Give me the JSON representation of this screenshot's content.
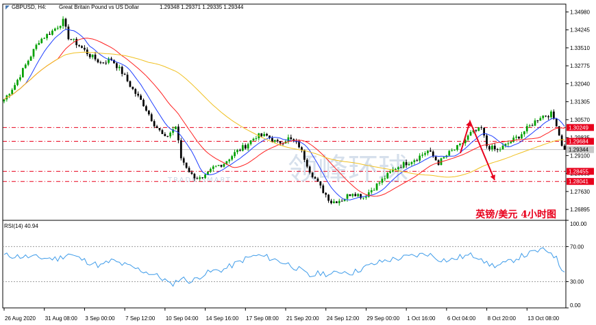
{
  "header": {
    "symbol": "GBPUSD, H4:",
    "description": "Great Britain Pound vs US Dollar",
    "ohlc": "1.29348 1.29371 1.29335 1.29344"
  },
  "annotation": {
    "title_cn": "英镑/美元 4小时图",
    "color": "#e8001c"
  },
  "watermark": {
    "latin": "TRADE SMART",
    "cn": "领峰环球",
    "color": "#c9d6e6"
  },
  "colors": {
    "up": "#00a000",
    "down": "#000000",
    "ma_fast": "#1f3fff",
    "ma_mid": "#ff2020",
    "ma_slow": "#f0c020",
    "level": "#e8001c",
    "rsi": "#3d9be9",
    "price_box": "#c8c8c8"
  },
  "chart_data": [
    {
      "type": "candlestick",
      "symbol": "GBPUSD",
      "timeframe": "H4",
      "ylim": [
        1.2645,
        1.353
      ],
      "yticks": [
        "1.34980",
        "1.34245",
        "1.33510",
        "1.32775",
        "1.32040",
        "1.31305",
        "1.30570",
        "1.29835",
        "1.29100",
        "1.28365",
        "1.27630",
        "1.26895"
      ],
      "xticks": [
        "26 Aug 2020",
        "31 Aug 08:00",
        "3 Sep 00:00",
        "7 Sep 12:00",
        "10 Sep 04:00",
        "14 Sep 16:00",
        "17 Sep 08:00",
        "21 Sep 20:00",
        "24 Sep 12:00",
        "29 Sep 00:00",
        "1 Oct 16:00",
        "6 Oct 04:00",
        "8 Oct 20:00",
        "13 Oct 08:00"
      ],
      "levels": [
        {
          "label": "1.30249",
          "value": 1.30249
        },
        {
          "label": "1.29684",
          "value": 1.29684
        },
        {
          "label": "1.28455",
          "value": 1.28455
        },
        {
          "label": "1.28041",
          "value": 1.28041
        }
      ],
      "current_price": {
        "label": "1.29344",
        "value": 1.29344
      },
      "anchors": [
        [
          0,
          1.314
        ],
        [
          4,
          1.32
        ],
        [
          9,
          1.33
        ],
        [
          13,
          1.338
        ],
        [
          18,
          1.342
        ],
        [
          22,
          1.346
        ],
        [
          24,
          1.3395
        ],
        [
          28,
          1.336
        ],
        [
          32,
          1.332
        ],
        [
          36,
          1.329
        ],
        [
          40,
          1.3305
        ],
        [
          44,
          1.325
        ],
        [
          48,
          1.318
        ],
        [
          52,
          1.312
        ],
        [
          56,
          1.304
        ],
        [
          60,
          1.298
        ],
        [
          64,
          1.303
        ],
        [
          66,
          1.29
        ],
        [
          70,
          1.283
        ],
        [
          74,
          1.281
        ],
        [
          78,
          1.286
        ],
        [
          82,
          1.288
        ],
        [
          86,
          1.292
        ],
        [
          90,
          1.295
        ],
        [
          94,
          1.299
        ],
        [
          98,
          1.299
        ],
        [
          102,
          1.296
        ],
        [
          106,
          1.298
        ],
        [
          110,
          1.295
        ],
        [
          114,
          1.285
        ],
        [
          118,
          1.278
        ],
        [
          122,
          1.272
        ],
        [
          126,
          1.273
        ],
        [
          130,
          1.276
        ],
        [
          134,
          1.274
        ],
        [
          138,
          1.278
        ],
        [
          142,
          1.282
        ],
        [
          146,
          1.286
        ],
        [
          150,
          1.288
        ],
        [
          154,
          1.29
        ],
        [
          158,
          1.293
        ],
        [
          162,
          1.288
        ],
        [
          166,
          1.292
        ],
        [
          170,
          1.295
        ],
        [
          174,
          1.3
        ],
        [
          178,
          1.302
        ],
        [
          180,
          1.295
        ],
        [
          184,
          1.293
        ],
        [
          188,
          1.296
        ],
        [
          192,
          1.299
        ],
        [
          196,
          1.303
        ],
        [
          200,
          1.307
        ],
        [
          204,
          1.308
        ],
        [
          206,
          1.304
        ],
        [
          208,
          1.295
        ],
        [
          209,
          1.2934
        ]
      ],
      "moving_averages": [
        {
          "period": 9,
          "color": "#1f3fff"
        },
        {
          "period": 21,
          "color": "#ff2020"
        },
        {
          "period": 55,
          "color": "#f0c020"
        }
      ],
      "projection": [
        [
          1.292
        ],
        [
          1.305
        ],
        [
          1.281
        ]
      ]
    },
    {
      "type": "line",
      "title": "RSI(14) 40.94",
      "ylim": [
        0,
        100
      ],
      "yticks": [
        "100.00",
        "70.00",
        "30.00",
        "0.00"
      ],
      "levels": [
        70,
        30
      ],
      "anchors": [
        [
          0,
          60
        ],
        [
          10,
          58
        ],
        [
          20,
          56
        ],
        [
          24,
          62
        ],
        [
          30,
          54
        ],
        [
          36,
          48
        ],
        [
          40,
          54
        ],
        [
          44,
          50
        ],
        [
          48,
          46
        ],
        [
          52,
          42
        ],
        [
          56,
          38
        ],
        [
          60,
          32
        ],
        [
          62,
          26
        ],
        [
          64,
          30
        ],
        [
          66,
          34
        ],
        [
          70,
          30
        ],
        [
          74,
          38
        ],
        [
          78,
          42
        ],
        [
          82,
          44
        ],
        [
          86,
          50
        ],
        [
          90,
          56
        ],
        [
          94,
          60
        ],
        [
          98,
          58
        ],
        [
          102,
          54
        ],
        [
          106,
          50
        ],
        [
          110,
          44
        ],
        [
          114,
          36
        ],
        [
          118,
          40
        ],
        [
          122,
          38
        ],
        [
          126,
          42
        ],
        [
          130,
          40
        ],
        [
          134,
          46
        ],
        [
          138,
          50
        ],
        [
          142,
          54
        ],
        [
          146,
          56
        ],
        [
          150,
          58
        ],
        [
          154,
          60
        ],
        [
          158,
          62
        ],
        [
          162,
          56
        ],
        [
          166,
          54
        ],
        [
          170,
          58
        ],
        [
          174,
          60
        ],
        [
          178,
          58
        ],
        [
          180,
          50
        ],
        [
          184,
          48
        ],
        [
          188,
          52
        ],
        [
          192,
          58
        ],
        [
          196,
          62
        ],
        [
          200,
          66
        ],
        [
          204,
          64
        ],
        [
          206,
          56
        ],
        [
          208,
          44
        ],
        [
          209,
          40.94
        ]
      ]
    }
  ]
}
